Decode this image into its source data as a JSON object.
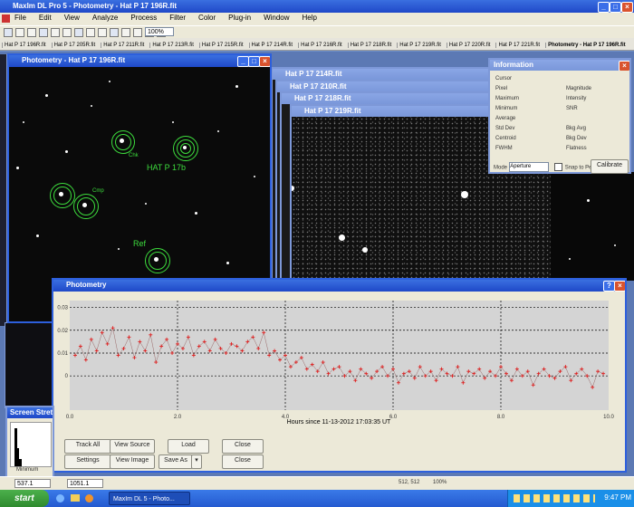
{
  "app": {
    "title": "MaxIm DL Pro 5 - Photometry - Hat P 17 196R.fit"
  },
  "menu": [
    "File",
    "Edit",
    "View",
    "Analyze",
    "Process",
    "Filter",
    "Color",
    "Plug-in",
    "Window",
    "Help"
  ],
  "toolbar": {
    "zoom_value": "100%"
  },
  "doc_tabs": [
    "Hat P 17 196R.fit",
    "Hat P 17 205R.fit",
    "Hat P 17 211R.fit",
    "Hat P 17 213R.fit",
    "Hat P 17 215R.fit",
    "Hat P 17 214R.fit",
    "Hat P 17 216R.fit",
    "Hat P 17 218R.fit",
    "Hat P 17 219R.fit",
    "Hat P 17 220R.fit",
    "Hat P 17 221R.fit",
    "Photometry - Hat P 17 196R.fit"
  ],
  "image_window": {
    "title": "Photometry - Hat P 17 196R.fit",
    "labels": {
      "target": "HAT P 17b",
      "ref": "Ref",
      "check": "Chk",
      "comp": "Cmp"
    }
  },
  "stacked_windows": [
    "Hat P 17 214R.fit",
    "Hat P 17 210R.fit",
    "Hat P 17 218R.fit",
    "Hat P 17 219R.fit"
  ],
  "info_window": {
    "title": "Information",
    "rows": [
      [
        "Cursor",
        ""
      ],
      [
        "Pixel",
        "Magnitude"
      ],
      [
        "Maximum",
        "Intensity"
      ],
      [
        "Minimum",
        "SNR"
      ],
      [
        "Average",
        ""
      ],
      [
        "Std Dev",
        "Bkg Avg"
      ],
      [
        "Centroid",
        "Bkg Dev"
      ],
      [
        "FWHM",
        "Flatness"
      ]
    ],
    "mode_label": "Mode",
    "mode_value": "Aperture",
    "snap_label": "Snap to Peak",
    "calibrate_label": "Calibrate"
  },
  "photometry_window": {
    "title": "Photometry",
    "xaxis_label": "Hours since 11-13-2012 17:03:35 UT",
    "buttons": {
      "track": "Track All",
      "view_source": "View Source",
      "load": "Load",
      "close": "Close",
      "settings": "Settings",
      "view_image": "View Image",
      "save_as": "Save As",
      "close2": "Close"
    }
  },
  "screen_stretch": {
    "title": "Screen Stretch",
    "min_label": "Minimum",
    "value": "537.1"
  },
  "status": {
    "coords": "512, 512",
    "value": "100%",
    "field": "1051.1"
  },
  "taskbar": {
    "start": "start",
    "task": "MaxIm DL 5 - Photo...",
    "clock": "9:47 PM"
  },
  "chart_data": {
    "type": "scatter",
    "title": "",
    "xlabel": "Hours since 11-13-2012 17:03:35 UT",
    "ylabel": "",
    "x_ticks": [
      "0.0",
      "2.0",
      "4.0",
      "6.0",
      "8.0",
      "10.0"
    ],
    "y_ticks": [
      "0.03",
      "0.02",
      "0.01",
      "0"
    ],
    "xlim": [
      0,
      10
    ],
    "ylim": [
      -0.015,
      0.033
    ],
    "grid": true,
    "series": [
      {
        "color": "#e02020",
        "x": [
          0.1,
          0.2,
          0.3,
          0.4,
          0.5,
          0.6,
          0.7,
          0.8,
          0.9,
          1.0,
          1.1,
          1.2,
          1.3,
          1.4,
          1.5,
          1.6,
          1.7,
          1.8,
          1.9,
          2.0,
          2.1,
          2.2,
          2.3,
          2.4,
          2.5,
          2.6,
          2.7,
          2.8,
          2.9,
          3.0,
          3.1,
          3.2,
          3.3,
          3.4,
          3.5,
          3.6,
          3.7,
          3.8,
          3.9,
          4.0,
          4.1,
          4.2,
          4.3,
          4.4,
          4.5,
          4.6,
          4.7,
          4.8,
          4.9,
          5.0,
          5.1,
          5.2,
          5.3,
          5.4,
          5.5,
          5.6,
          5.7,
          5.8,
          5.9,
          6.0,
          6.1,
          6.2,
          6.3,
          6.4,
          6.5,
          6.6,
          6.7,
          6.8,
          6.9,
          7.0,
          7.1,
          7.2,
          7.3,
          7.4,
          7.5,
          7.6,
          7.7,
          7.8,
          7.9,
          8.0,
          8.1,
          8.2,
          8.3,
          8.4,
          8.5,
          8.6,
          8.7,
          8.8,
          8.9,
          9.0,
          9.1,
          9.2,
          9.3,
          9.4,
          9.5,
          9.6,
          9.7,
          9.8,
          9.9
        ],
        "y": [
          0.009,
          0.013,
          0.007,
          0.016,
          0.011,
          0.019,
          0.014,
          0.021,
          0.009,
          0.012,
          0.017,
          0.008,
          0.015,
          0.011,
          0.018,
          0.006,
          0.013,
          0.016,
          0.01,
          0.014,
          0.012,
          0.017,
          0.009,
          0.013,
          0.015,
          0.011,
          0.016,
          0.012,
          0.01,
          0.014,
          0.013,
          0.011,
          0.015,
          0.017,
          0.012,
          0.019,
          0.009,
          0.011,
          0.007,
          0.009,
          0.004,
          0.006,
          0.008,
          0.003,
          0.005,
          0.002,
          0.006,
          0.001,
          0.003,
          0.004,
          0.0,
          0.002,
          -0.002,
          0.003,
          0.001,
          -0.001,
          0.002,
          0.004,
          0.0,
          0.003,
          -0.003,
          0.001,
          0.002,
          -0.001,
          0.004,
          0.0,
          0.002,
          -0.002,
          0.003,
          0.001,
          0.0,
          0.004,
          -0.003,
          0.002,
          0.001,
          0.003,
          -0.001,
          0.002,
          0.0,
          0.004,
          0.001,
          -0.002,
          0.003,
          0.0,
          0.002,
          -0.004,
          0.001,
          0.003,
          0.0,
          -0.001,
          0.002,
          0.004,
          -0.002,
          0.001,
          0.003,
          0.0,
          -0.005,
          0.002,
          0.001
        ]
      }
    ]
  }
}
